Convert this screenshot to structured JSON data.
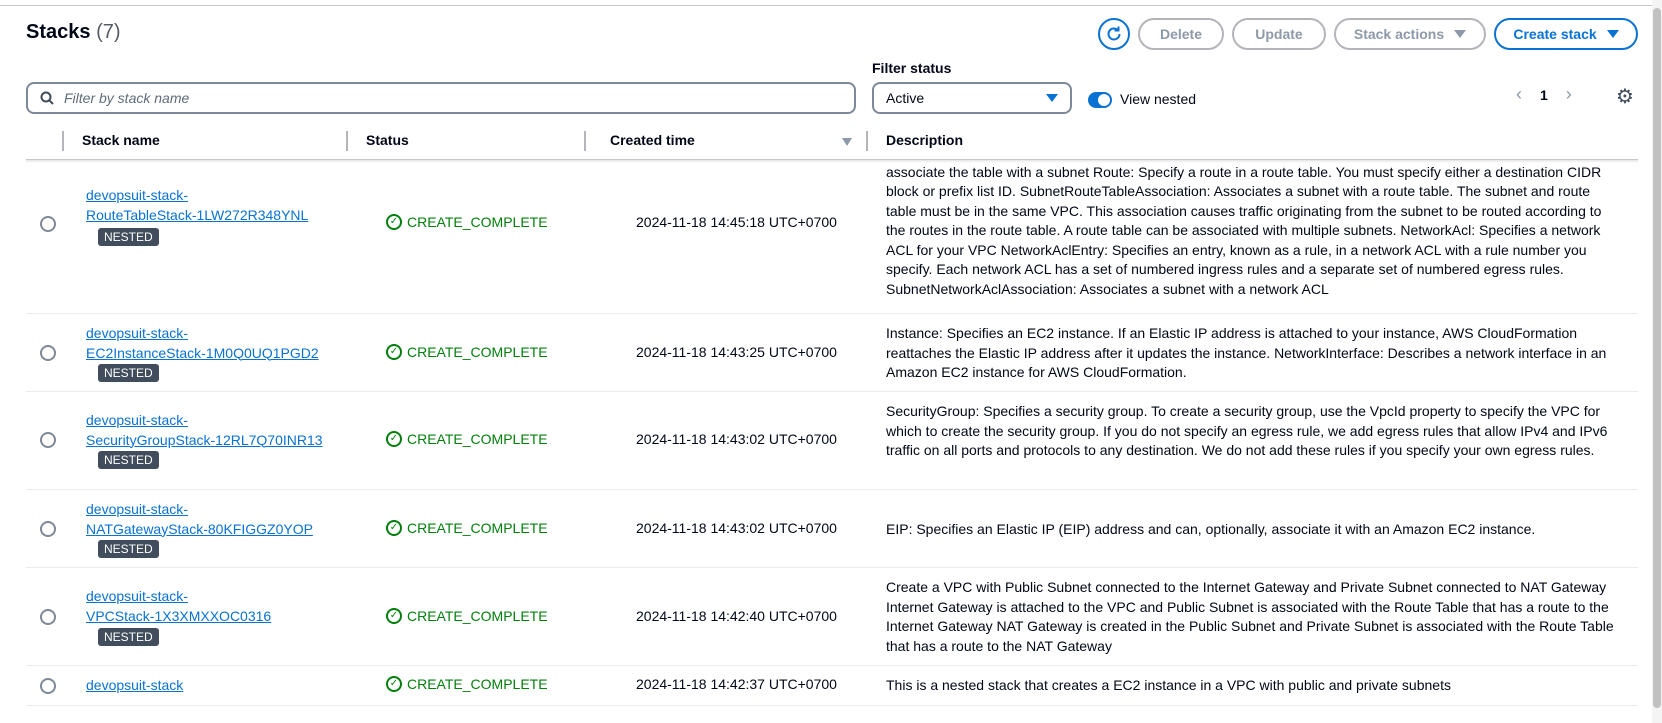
{
  "header": {
    "title": "Stacks",
    "count": "(7)"
  },
  "toolbar": {
    "refresh_icon": "refresh-icon",
    "delete_label": "Delete",
    "update_label": "Update",
    "actions_label": "Stack actions",
    "create_label": "Create stack",
    "accent_color": "#0972d3"
  },
  "search": {
    "placeholder": "Filter by stack name",
    "value": ""
  },
  "filter": {
    "label": "Filter status",
    "selected": "Active"
  },
  "view_nested": {
    "label": "View nested",
    "enabled": true
  },
  "pagination": {
    "page": "1"
  },
  "columns": {
    "name": "Stack name",
    "status": "Status",
    "created": "Created time",
    "description": "Description"
  },
  "rows": [
    {
      "name_line1": "devopsuit-stack-",
      "name_line2": "RouteTableStack-1LW272R348YNL",
      "badge": "NESTED",
      "status": "CREATE_COMPLETE",
      "created": "2024-11-18 14:45:18 UTC+0700",
      "description": "RouteTable: Specifies a route table for the specified VPC. After creating a route table, you can add routes and associate the table with a subnet Route: Specify a route in a route table. You must specify either a destination CIDR block or prefix list ID. SubnetRouteTableAssociation: Associates a subnet with a route table. The subnet and route table must be in the same VPC. This association causes traffic originating from the subnet to be routed according to the routes in the route table. A route table can be associated with multiple subnets. NetworkAcl: Specifies a network ACL for your VPC NetworkAclEntry: Specifies an entry, known as a rule, in a network ACL with a rule number you specify. Each network ACL has a set of numbered ingress rules and a separate set of numbered egress rules. SubnetNetworkAclAssociation: Associates a subnet with a network ACL"
    },
    {
      "name_line1": "devopsuit-stack-",
      "name_line2": "EC2InstanceStack-1M0Q0UQ1PGD2",
      "badge": "NESTED",
      "status": "CREATE_COMPLETE",
      "created": "2024-11-18 14:43:25 UTC+0700",
      "description": "Instance: Specifies an EC2 instance. If an Elastic IP address is attached to your instance, AWS CloudFormation reattaches the Elastic IP address after it updates the instance. NetworkInterface: Describes a network interface in an Amazon EC2 instance for AWS CloudFormation."
    },
    {
      "name_line1": "devopsuit-stack-",
      "name_line2": "SecurityGroupStack-12RL7Q70INR13",
      "badge": "NESTED",
      "status": "CREATE_COMPLETE",
      "created": "2024-11-18 14:43:02 UTC+0700",
      "description": "SecurityGroup: Specifies a security group. To create a security group, use the VpcId property to specify the VPC for which to create the security group. If you do not specify an egress rule, we add egress rules that allow IPv4 and IPv6 traffic on all ports and protocols to any destination. We do not add these rules if you specify your own egress rules."
    },
    {
      "name_line1": "devopsuit-stack-",
      "name_line2": "NATGatewayStack-80KFIGGZ0YOP",
      "badge": "NESTED",
      "status": "CREATE_COMPLETE",
      "created": "2024-11-18 14:43:02 UTC+0700",
      "description": "EIP: Specifies an Elastic IP (EIP) address and can, optionally, associate it with an Amazon EC2 instance."
    },
    {
      "name_line1": "devopsuit-stack-",
      "name_line2": "VPCStack-1X3XMXXOC0316",
      "badge": "NESTED",
      "status": "CREATE_COMPLETE",
      "created": "2024-11-18 14:42:40 UTC+0700",
      "description": "Create a VPC with Public Subnet connected to the Internet Gateway and Private Subnet connected to NAT Gateway Internet Gateway is attached to the VPC and Public Subnet is associated with the Route Table that has a route to the Internet Gateway NAT Gateway is created in the Public Subnet and Private Subnet is associated with the Route Table that has a route to the NAT Gateway"
    },
    {
      "name_line1": "devopsuit-stack",
      "name_line2": "",
      "badge": "",
      "status": "CREATE_COMPLETE",
      "created": "2024-11-18 14:42:37 UTC+0700",
      "description": "This is a nested stack that creates a EC2 instance in a VPC with public and private subnets"
    }
  ]
}
